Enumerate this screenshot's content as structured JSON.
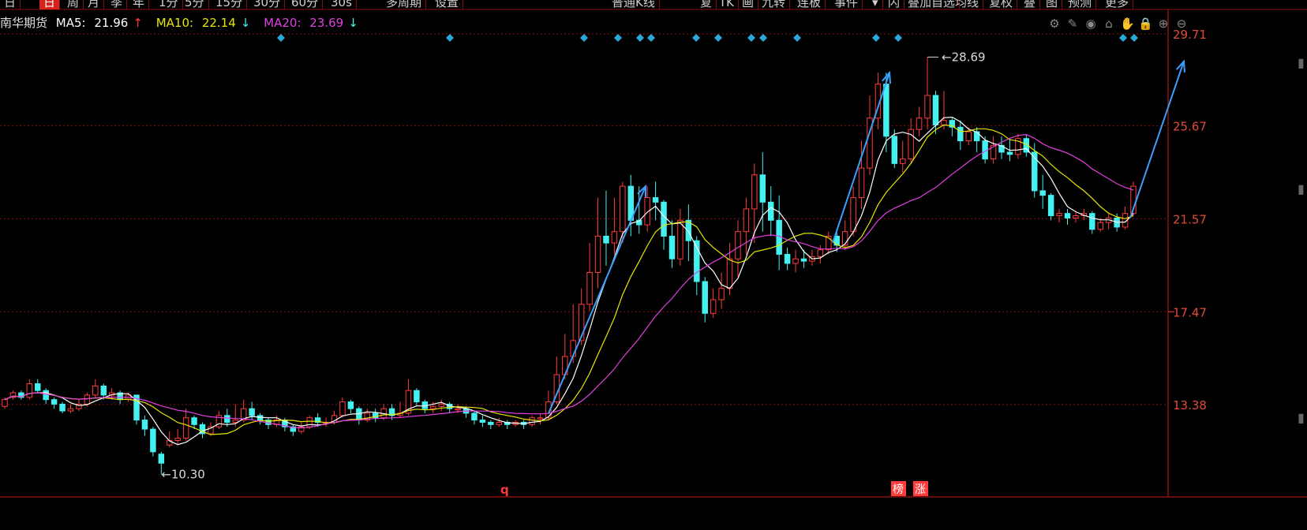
{
  "toolbar": {
    "left": [
      {
        "label": "日",
        "active": false
      },
      {
        "label": "日",
        "active": true
      },
      {
        "label": "周",
        "active": false
      },
      {
        "label": "月",
        "active": false
      },
      {
        "label": "季",
        "active": false
      },
      {
        "label": "年",
        "active": false
      },
      {
        "label": "1分",
        "active": false
      },
      {
        "label": "5分",
        "active": false
      },
      {
        "label": "15分",
        "active": false
      },
      {
        "label": "30分",
        "active": false
      },
      {
        "label": "60分",
        "active": false
      },
      {
        "label": "30s",
        "active": false
      },
      {
        "label": "多周期",
        "active": false
      },
      {
        "label": "设置",
        "active": false
      }
    ],
    "right": [
      {
        "label": "普通K线"
      },
      {
        "label": "复"
      },
      {
        "label": "TK"
      },
      {
        "label": "画"
      },
      {
        "label": "九转"
      },
      {
        "label": "连板"
      },
      {
        "label": "事件"
      },
      {
        "label": "▾"
      },
      {
        "label": "闪"
      },
      {
        "label": "叠加自选"
      },
      {
        "label": "均线"
      },
      {
        "label": "复权"
      },
      {
        "label": "叠"
      },
      {
        "label": "图"
      },
      {
        "label": "预测"
      },
      {
        "label": "更多"
      }
    ]
  },
  "info": {
    "name": "南华期货",
    "ma5_label": "MA5:",
    "ma5_value": "21.96",
    "ma5_arrow": "↑",
    "ma10_label": "MA10:",
    "ma10_value": "22.14",
    "ma10_arrow": "↓",
    "ma20_label": "MA20:",
    "ma20_value": "23.69",
    "ma20_arrow": "↓"
  },
  "tools": [
    "gear-icon",
    "pen-icon",
    "eye-icon",
    "bank-icon",
    "hand-icon",
    "lock-icon",
    "zoom-in-icon",
    "zoom-out-icon"
  ],
  "colors": {
    "up": "#ff3b3b",
    "down": "#44f0f0",
    "ma5": "#ffffff",
    "ma10": "#e6e600",
    "ma20": "#e040e0",
    "grid": "#8a1010",
    "axis_text": "#e24a3a",
    "annotation": "#d9d9d9",
    "arrow": "#3aa0ff",
    "marker": "#2aa8d8"
  },
  "chart_data": {
    "type": "candlestick",
    "y_ticks": [
      29.71,
      25.67,
      21.57,
      17.47,
      13.38
    ],
    "ylim": [
      9.8,
      29.71
    ],
    "high_label": "28.69",
    "low_label": "10.30",
    "bottom_markers": [
      "q",
      "榜",
      "涨"
    ],
    "candles": [
      [
        13.3,
        13.6,
        13.2,
        13.7
      ],
      [
        13.7,
        13.9,
        13.6,
        14.0
      ],
      [
        13.9,
        13.7,
        13.6,
        14.0
      ],
      [
        13.7,
        14.3,
        13.6,
        14.5
      ],
      [
        14.3,
        14.0,
        13.9,
        14.5
      ],
      [
        14.0,
        13.6,
        13.4,
        14.1
      ],
      [
        13.6,
        13.4,
        13.2,
        13.7
      ],
      [
        13.4,
        13.1,
        13.0,
        13.5
      ],
      [
        13.1,
        13.2,
        13.0,
        13.4
      ],
      [
        13.2,
        13.4,
        13.1,
        13.6
      ],
      [
        13.4,
        13.8,
        13.3,
        13.9
      ],
      [
        13.8,
        14.2,
        13.7,
        14.5
      ],
      [
        14.2,
        13.8,
        13.6,
        14.3
      ],
      [
        13.8,
        13.9,
        13.6,
        14.1
      ],
      [
        13.9,
        13.6,
        13.4,
        14.0
      ],
      [
        13.6,
        13.8,
        13.5,
        13.9
      ],
      [
        13.8,
        12.7,
        12.5,
        13.8
      ],
      [
        12.7,
        12.3,
        12.0,
        12.9
      ],
      [
        12.3,
        11.3,
        11.1,
        12.4
      ],
      [
        11.2,
        10.8,
        10.3,
        11.3
      ],
      [
        11.6,
        11.8,
        11.5,
        12.2
      ],
      [
        11.8,
        11.9,
        11.6,
        12.3
      ],
      [
        11.9,
        12.8,
        11.8,
        13.2
      ],
      [
        12.8,
        12.5,
        12.3,
        12.9
      ],
      [
        12.5,
        12.1,
        11.9,
        12.6
      ],
      [
        12.1,
        12.4,
        12.0,
        12.6
      ],
      [
        12.4,
        12.9,
        12.3,
        13.1
      ],
      [
        12.9,
        12.6,
        12.4,
        13.2
      ],
      [
        12.6,
        12.7,
        12.4,
        13.4
      ],
      [
        12.7,
        13.2,
        12.6,
        13.6
      ],
      [
        13.2,
        12.9,
        12.7,
        13.5
      ],
      [
        12.9,
        12.7,
        12.5,
        13.0
      ],
      [
        12.7,
        12.5,
        12.3,
        12.8
      ],
      [
        12.5,
        12.7,
        12.4,
        12.9
      ],
      [
        12.7,
        12.4,
        12.2,
        12.8
      ],
      [
        12.4,
        12.2,
        12.0,
        12.5
      ],
      [
        12.2,
        12.4,
        12.1,
        12.6
      ],
      [
        12.4,
        12.8,
        12.3,
        12.9
      ],
      [
        12.8,
        12.6,
        12.4,
        13.0
      ],
      [
        12.6,
        12.6,
        12.4,
        12.8
      ],
      [
        12.6,
        12.9,
        12.5,
        13.1
      ],
      [
        12.9,
        13.5,
        12.8,
        13.7
      ],
      [
        13.5,
        13.2,
        13.0,
        13.6
      ],
      [
        13.2,
        12.7,
        12.5,
        13.3
      ],
      [
        12.7,
        13.0,
        12.6,
        13.2
      ],
      [
        13.0,
        12.8,
        12.6,
        13.2
      ],
      [
        12.8,
        13.2,
        12.7,
        13.4
      ],
      [
        13.2,
        12.9,
        12.7,
        13.4
      ],
      [
        12.9,
        13.0,
        12.8,
        13.5
      ],
      [
        13.0,
        14.0,
        12.9,
        14.5
      ],
      [
        14.0,
        13.5,
        13.3,
        14.1
      ],
      [
        13.5,
        13.2,
        13.0,
        13.6
      ],
      [
        13.2,
        13.3,
        13.0,
        13.5
      ],
      [
        13.3,
        13.4,
        13.1,
        13.6
      ],
      [
        13.4,
        13.2,
        13.0,
        13.5
      ],
      [
        13.2,
        13.2,
        13.0,
        13.4
      ],
      [
        13.2,
        13.0,
        12.8,
        13.3
      ],
      [
        13.0,
        12.7,
        12.5,
        13.1
      ],
      [
        12.7,
        12.6,
        12.4,
        12.9
      ],
      [
        12.6,
        12.5,
        12.3,
        12.7
      ],
      [
        12.5,
        12.6,
        12.4,
        12.8
      ],
      [
        12.6,
        12.5,
        12.3,
        12.7
      ],
      [
        12.5,
        12.6,
        12.4,
        12.7
      ],
      [
        12.6,
        12.5,
        12.3,
        12.7
      ],
      [
        12.5,
        12.8,
        12.4,
        12.9
      ],
      [
        12.8,
        12.8,
        12.5,
        13.0
      ],
      [
        12.8,
        13.5,
        12.7,
        14.0
      ],
      [
        13.5,
        14.7,
        13.4,
        15.5
      ],
      [
        14.7,
        15.5,
        14.5,
        16.5
      ],
      [
        15.5,
        16.2,
        15.2,
        17.8
      ],
      [
        16.2,
        17.8,
        16.0,
        18.5
      ],
      [
        17.8,
        19.2,
        17.5,
        20.5
      ],
      [
        19.2,
        20.8,
        18.5,
        22.5
      ],
      [
        20.8,
        20.5,
        19.5,
        22.8
      ],
      [
        20.5,
        21.0,
        20.0,
        22.5
      ],
      [
        21.0,
        23.0,
        20.5,
        23.2
      ],
      [
        23.0,
        21.5,
        20.8,
        23.5
      ],
      [
        21.5,
        21.3,
        20.9,
        23.0
      ],
      [
        21.3,
        22.5,
        21.0,
        23.0
      ],
      [
        22.5,
        22.3,
        21.5,
        23.2
      ],
      [
        22.3,
        20.8,
        20.2,
        22.4
      ],
      [
        20.8,
        19.8,
        19.4,
        21.5
      ],
      [
        19.8,
        21.5,
        19.5,
        22.0
      ],
      [
        21.5,
        20.6,
        19.7,
        22.2
      ],
      [
        20.6,
        18.8,
        18.2,
        20.8
      ],
      [
        18.8,
        17.4,
        17.0,
        19.0
      ],
      [
        17.4,
        18.0,
        17.2,
        18.5
      ],
      [
        18.0,
        18.5,
        17.6,
        19.2
      ],
      [
        18.5,
        19.8,
        18.2,
        20.5
      ],
      [
        19.8,
        21.0,
        19.0,
        21.5
      ],
      [
        21.0,
        22.0,
        20.0,
        22.5
      ],
      [
        22.0,
        23.5,
        20.5,
        24.0
      ],
      [
        23.5,
        22.3,
        21.0,
        24.5
      ],
      [
        22.3,
        21.5,
        20.8,
        23.0
      ],
      [
        21.5,
        20.0,
        19.3,
        22.6
      ],
      [
        20.0,
        19.6,
        19.3,
        20.3
      ],
      [
        19.6,
        19.8,
        19.2,
        20.2
      ],
      [
        19.8,
        19.7,
        19.4,
        20.2
      ],
      [
        19.7,
        19.9,
        19.5,
        20.2
      ],
      [
        19.9,
        20.2,
        19.6,
        20.4
      ],
      [
        20.2,
        20.8,
        20.0,
        21.0
      ],
      [
        20.8,
        20.4,
        20.1,
        21.0
      ],
      [
        20.4,
        21.0,
        20.2,
        21.5
      ],
      [
        21.0,
        22.5,
        20.8,
        23.0
      ],
      [
        22.5,
        23.8,
        22.0,
        25.0
      ],
      [
        23.8,
        26.0,
        23.5,
        27.0
      ],
      [
        26.0,
        27.5,
        25.5,
        28.0
      ],
      [
        27.5,
        25.2,
        24.5,
        28.0
      ],
      [
        25.2,
        24.0,
        23.8,
        25.5
      ],
      [
        24.0,
        24.2,
        23.6,
        25.0
      ],
      [
        24.2,
        25.5,
        24.0,
        26.0
      ],
      [
        25.5,
        26.0,
        25.2,
        26.5
      ],
      [
        26.0,
        27.0,
        25.5,
        28.69
      ],
      [
        27.0,
        25.7,
        25.3,
        27.2
      ],
      [
        25.7,
        25.9,
        25.5,
        27.2
      ],
      [
        25.9,
        25.6,
        25.2,
        26.0
      ],
      [
        25.6,
        25.0,
        24.6,
        25.9
      ],
      [
        25.0,
        25.4,
        24.8,
        25.6
      ],
      [
        25.4,
        25.0,
        24.5,
        25.6
      ],
      [
        25.0,
        24.2,
        24.0,
        25.2
      ],
      [
        24.2,
        24.8,
        24.0,
        25.2
      ],
      [
        24.8,
        24.5,
        24.2,
        25.2
      ],
      [
        24.5,
        24.4,
        24.1,
        25.1
      ],
      [
        24.4,
        25.1,
        24.2,
        25.3
      ],
      [
        25.1,
        24.5,
        24.3,
        25.3
      ],
      [
        24.5,
        22.8,
        22.5,
        24.9
      ],
      [
        22.8,
        22.6,
        22.0,
        23.5
      ],
      [
        22.6,
        21.7,
        21.5,
        22.7
      ],
      [
        21.7,
        21.8,
        21.4,
        22.0
      ],
      [
        21.8,
        21.6,
        21.3,
        22.0
      ],
      [
        21.6,
        21.7,
        21.4,
        21.9
      ],
      [
        21.7,
        21.8,
        21.5,
        22.0
      ],
      [
        21.8,
        21.1,
        20.9,
        21.9
      ],
      [
        21.1,
        21.4,
        21.0,
        21.6
      ],
      [
        21.4,
        21.6,
        21.1,
        21.8
      ],
      [
        21.6,
        21.2,
        21.0,
        21.8
      ],
      [
        21.2,
        21.8,
        21.1,
        22.1
      ],
      [
        21.8,
        23.0,
        21.7,
        23.2
      ]
    ],
    "marker_rows": [
      356,
      570,
      740,
      783,
      811,
      825,
      882,
      910,
      952,
      967,
      1010,
      1110,
      1138,
      1423,
      1437
    ],
    "trend_arrows": [
      {
        "from": [
          695,
          13.0
        ],
        "to": [
          818,
          23.0
        ]
      },
      {
        "from": [
          1055,
          20.5
        ],
        "to": [
          1127,
          28.0
        ]
      },
      {
        "from": [
          1432,
          21.6
        ],
        "to": [
          1500,
          28.5
        ]
      }
    ]
  }
}
